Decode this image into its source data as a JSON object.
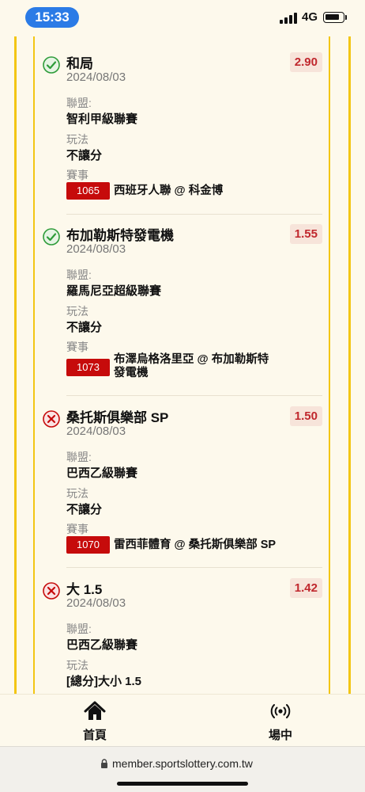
{
  "status": {
    "time": "15:33",
    "network": "4G"
  },
  "labels": {
    "league": "聯盟:",
    "play_type": "玩法",
    "event": "賽事"
  },
  "bets": [
    {
      "result": "win",
      "title": "和局",
      "date": "2024/08/03",
      "odds": "2.90",
      "league": "智利甲級聯賽",
      "play_type": "不讓分",
      "match_no": "1065",
      "match": "西班牙人聯 @ 科金博"
    },
    {
      "result": "win",
      "title": "布加勒斯特發電機",
      "date": "2024/08/03",
      "odds": "1.55",
      "league": "羅馬尼亞超級聯賽",
      "play_type": "不讓分",
      "match_no": "1073",
      "match_line1": "布澤烏格洛里亞 @ 布加勒斯特",
      "match_line2": "發電機"
    },
    {
      "result": "loss",
      "title": "桑托斯俱樂部 SP",
      "date": "2024/08/03",
      "odds": "1.50",
      "league": "巴西乙級聯賽",
      "play_type": "不讓分",
      "match_no": "1070",
      "match": "雷西菲體育 @ 桑托斯俱樂部 SP"
    },
    {
      "result": "loss",
      "title": "大 1.5",
      "date": "2024/08/03",
      "odds": "1.42",
      "league": "巴西乙級聯賽",
      "play_type": "[總分]大小 1.5"
    }
  ],
  "nav": {
    "home_label": "首頁",
    "live_label": "場中"
  },
  "browser": {
    "url": "member.sportslottery.com.tw"
  },
  "colors": {
    "accent_yellow": "#f3c614",
    "win_green": "#2e9c3a",
    "loss_red": "#c60b0b",
    "odds_bg": "#f7e4da"
  },
  "icons": {
    "win": "check-circle-icon",
    "loss": "x-circle-icon",
    "home": "home-icon",
    "live": "live-broadcast-icon",
    "lock": "lock-icon"
  }
}
